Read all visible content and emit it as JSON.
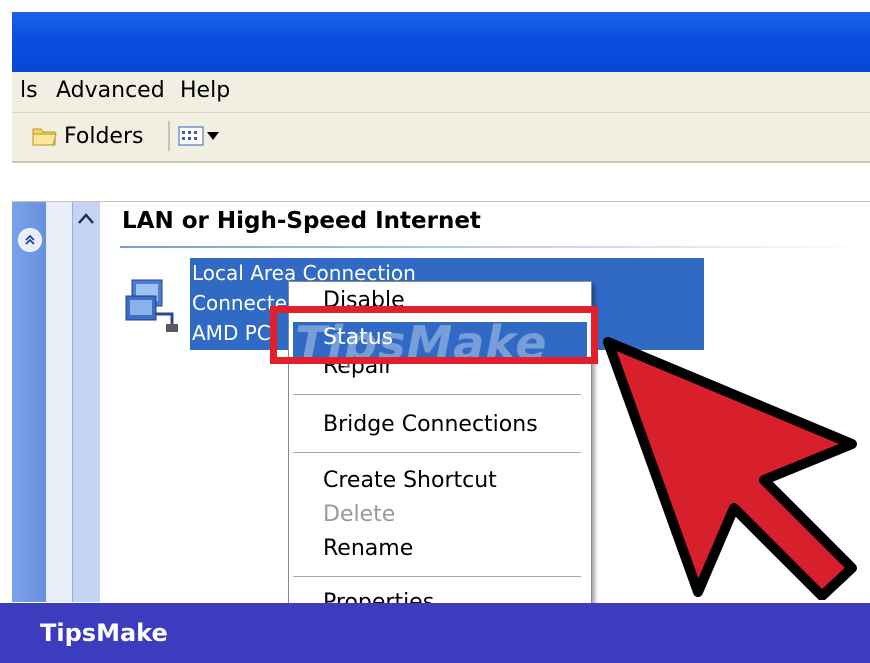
{
  "menubar": {
    "items": [
      "ls",
      "Advanced",
      "Help"
    ]
  },
  "toolbar": {
    "folders_label": "Folders",
    "views_icon": "views-grid-icon"
  },
  "group": {
    "heading": "LAN or High-Speed Internet"
  },
  "connection": {
    "lines": [
      "Local Area Connection",
      "Connecte",
      "AMD PC"
    ],
    "icon": "network-connection-icon"
  },
  "context_menu": {
    "items": [
      {
        "label": "Disable",
        "state": "normal"
      },
      {
        "label": "Status",
        "state": "highlighted"
      },
      {
        "label": "Repair",
        "state": "normal"
      },
      {
        "label": "Bridge Connections",
        "state": "normal"
      },
      {
        "label": "Create Shortcut",
        "state": "normal"
      },
      {
        "label": "Delete",
        "state": "disabled"
      },
      {
        "label": "Rename",
        "state": "normal"
      },
      {
        "label": "Properties",
        "state": "normal"
      }
    ]
  },
  "watermark": "TipsMake",
  "footer": {
    "brand": "TipsMake"
  },
  "colors": {
    "titlebar": "#0b4ee0",
    "selection": "#316ac5",
    "annotation_red": "#e41e2a",
    "footer": "#3b3dbe"
  }
}
